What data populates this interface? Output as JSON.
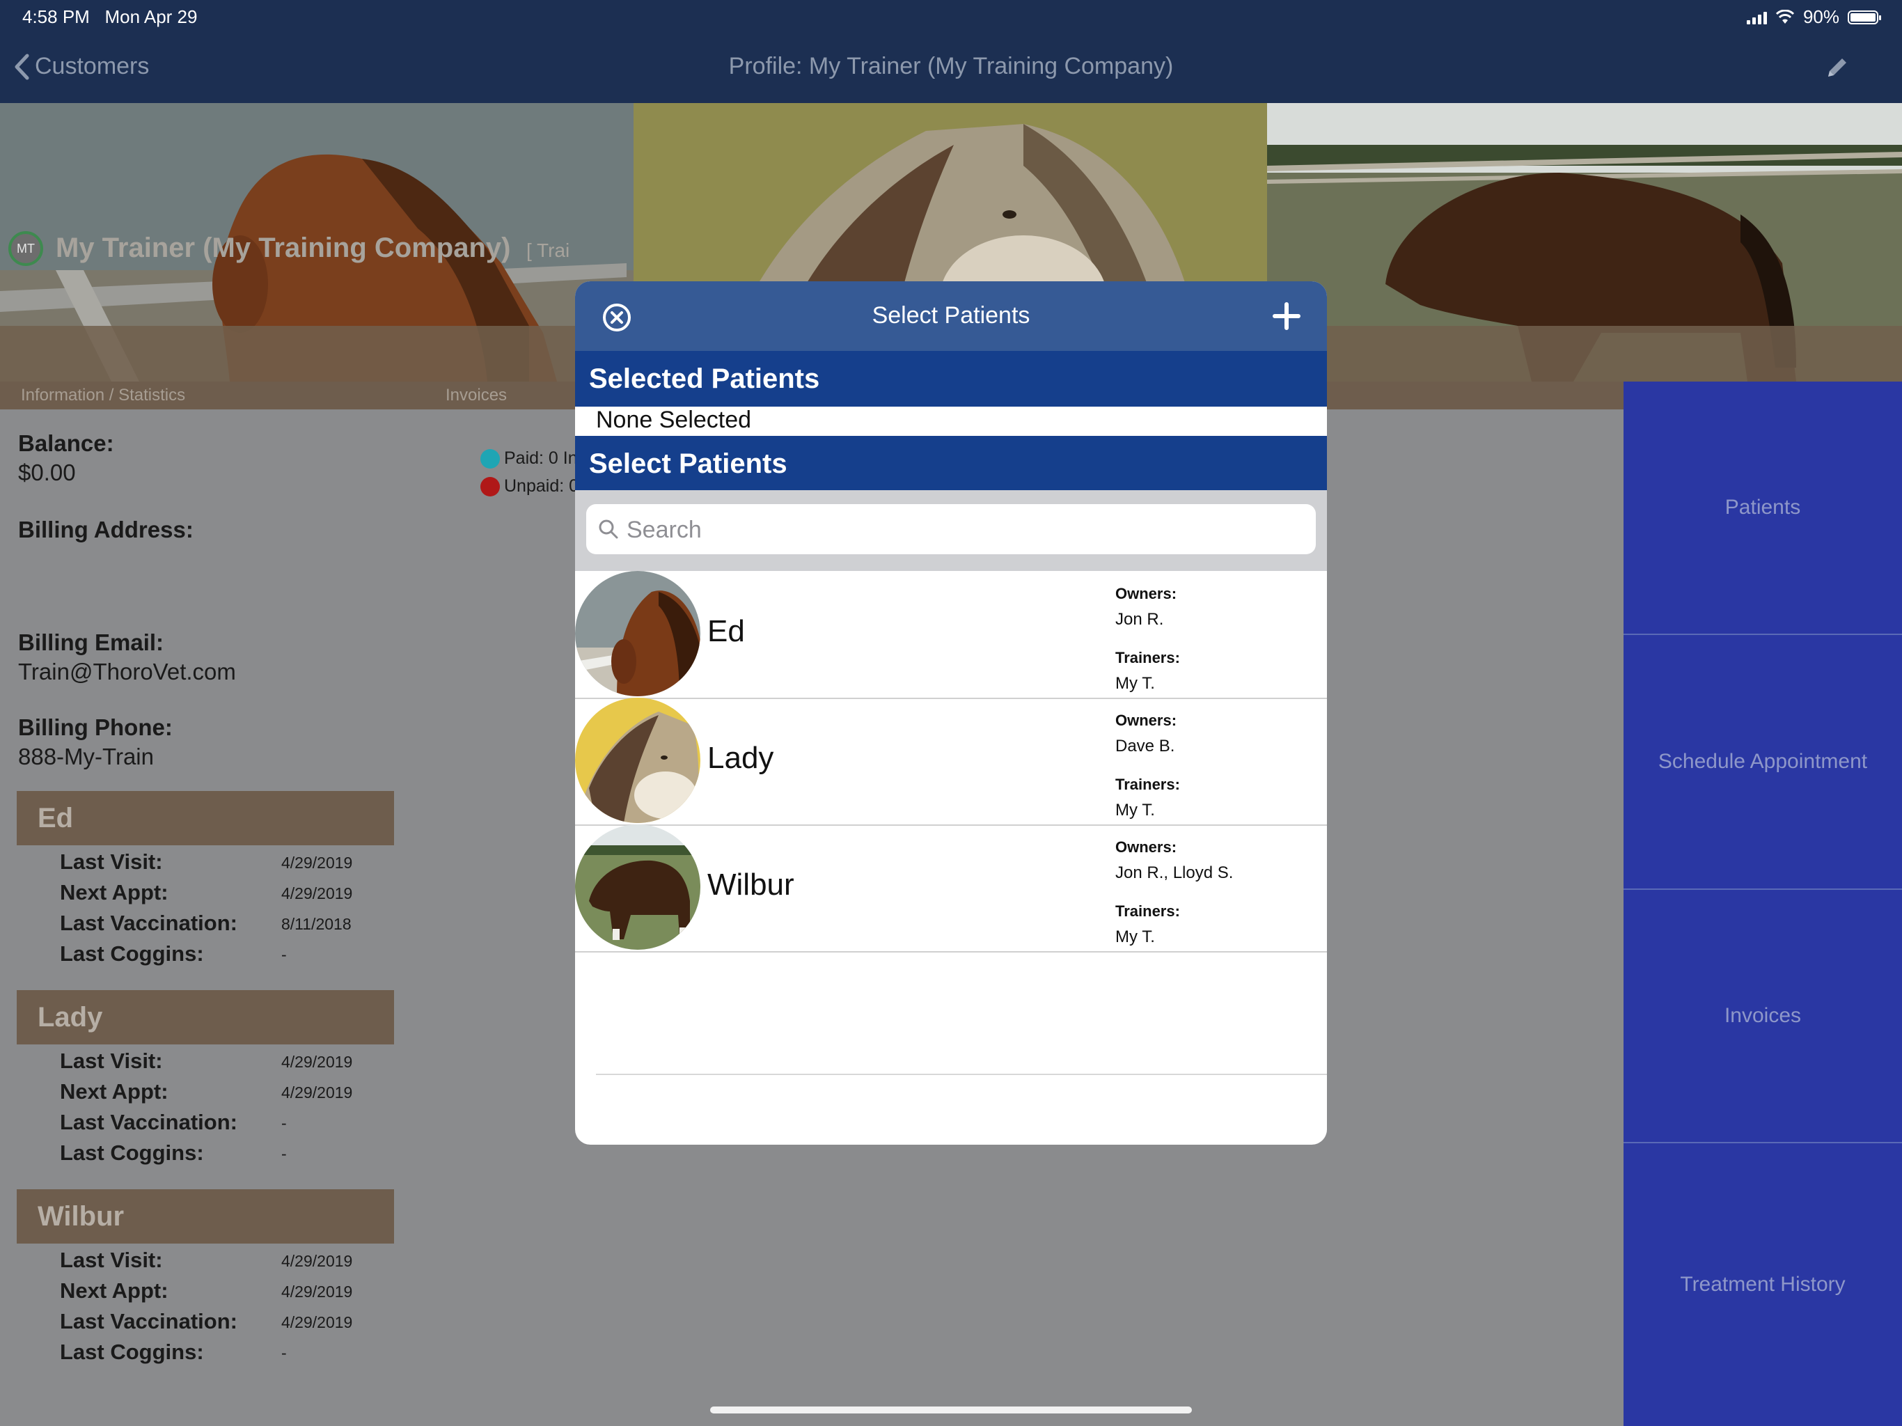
{
  "status_bar": {
    "time": "4:58 PM",
    "date": "Mon Apr 29",
    "battery": "90%",
    "battery_level": 0.9,
    "signal_icon": "signal-icon",
    "wifi_icon": "wifi-icon"
  },
  "nav": {
    "back_label": "Customers",
    "title": "Profile: My Trainer (My Training Company)",
    "edit_icon": "pencil-icon"
  },
  "customer": {
    "initials": "MT",
    "name": "My Trainer (My Training Company)",
    "type_label": "[ Trai",
    "tabs": [
      "Information / Statistics",
      "Invoices"
    ],
    "balance_label": "Balance:",
    "balance": "$0.00",
    "billing_address_label": "Billing Address:",
    "billing_email_label": "Billing Email:",
    "billing_email": "Train@ThoroVet.com",
    "billing_phone_label": "Billing Phone:",
    "billing_phone": "888-My-Train"
  },
  "invoice_legend": {
    "paid": "Paid: 0 In",
    "unpaid": "Unpaid: 0",
    "paid_color": "#1fa5b4",
    "unpaid_color": "#b01818"
  },
  "patient_cards": [
    {
      "name": "Ed",
      "rows": [
        {
          "k": "Last Visit:",
          "v": "4/29/2019"
        },
        {
          "k": "Next Appt:",
          "v": "4/29/2019"
        },
        {
          "k": "Last Vaccination:",
          "v": "8/11/2018"
        },
        {
          "k": "Last Coggins:",
          "v": "-"
        }
      ]
    },
    {
      "name": "Lady",
      "rows": [
        {
          "k": "Last Visit:",
          "v": "4/29/2019"
        },
        {
          "k": "Next Appt:",
          "v": "4/29/2019"
        },
        {
          "k": "Last Vaccination:",
          "v": "-"
        },
        {
          "k": "Last Coggins:",
          "v": "-"
        }
      ]
    },
    {
      "name": "Wilbur",
      "rows": [
        {
          "k": "Last Visit:",
          "v": "4/29/2019"
        },
        {
          "k": "Next Appt:",
          "v": "4/29/2019"
        },
        {
          "k": "Last Vaccination:",
          "v": "4/29/2019"
        },
        {
          "k": "Last Coggins:",
          "v": "-"
        }
      ]
    }
  ],
  "side_menu": [
    "Patients",
    "Schedule Appointment",
    "Invoices",
    "Treatment History"
  ],
  "modal": {
    "title": "Select Patients",
    "close_icon": "close-circle-icon",
    "add_icon": "plus-icon",
    "selected_header": "Selected Patients",
    "none_selected": "None Selected",
    "select_header": "Select Patients",
    "search_placeholder": "Search",
    "owners_label": "Owners:",
    "trainers_label": "Trainers:",
    "patients": [
      {
        "name": "Ed",
        "owners": "Jon R.",
        "trainers": "My T."
      },
      {
        "name": "Lady",
        "owners": "Dave B.",
        "trainers": "My T."
      },
      {
        "name": "Wilbur",
        "owners": "Jon R., Lloyd S.",
        "trainers": "My T."
      }
    ]
  },
  "colors": {
    "nav_bg": "#1c2f52",
    "modal_header": "#365a95",
    "section_header": "#153f8c",
    "side_panel": "#2a37a3",
    "card_header": "#6e5d4d"
  }
}
